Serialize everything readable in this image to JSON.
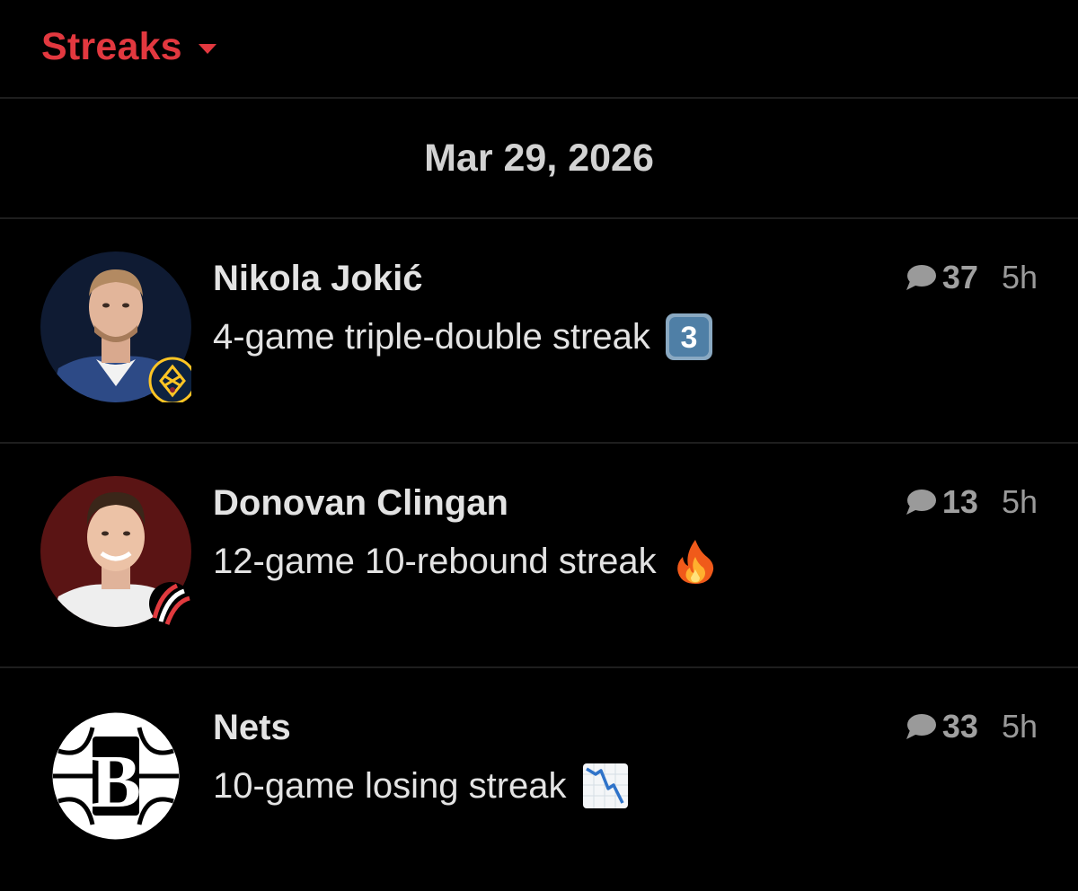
{
  "header": {
    "title": "Streaks"
  },
  "date": "Mar 29, 2026",
  "colors": {
    "accent": "#e2383f",
    "background": "#000000",
    "divider": "#1e1e1e",
    "muted": "#9a9a9a"
  },
  "streaks": [
    {
      "name": "Nikola Jokić",
      "description": "4-game triple-double streak",
      "emoji": "keycap-3-icon",
      "comments": "37",
      "time": "5h",
      "team": "nuggets"
    },
    {
      "name": "Donovan Clingan",
      "description": "12-game 10-rebound streak",
      "emoji": "fire-icon",
      "comments": "13",
      "time": "5h",
      "team": "trail-blazers"
    },
    {
      "name": "Nets",
      "description": "10-game losing streak",
      "emoji": "chart-decreasing-icon",
      "comments": "33",
      "time": "5h",
      "team": "nets"
    }
  ]
}
